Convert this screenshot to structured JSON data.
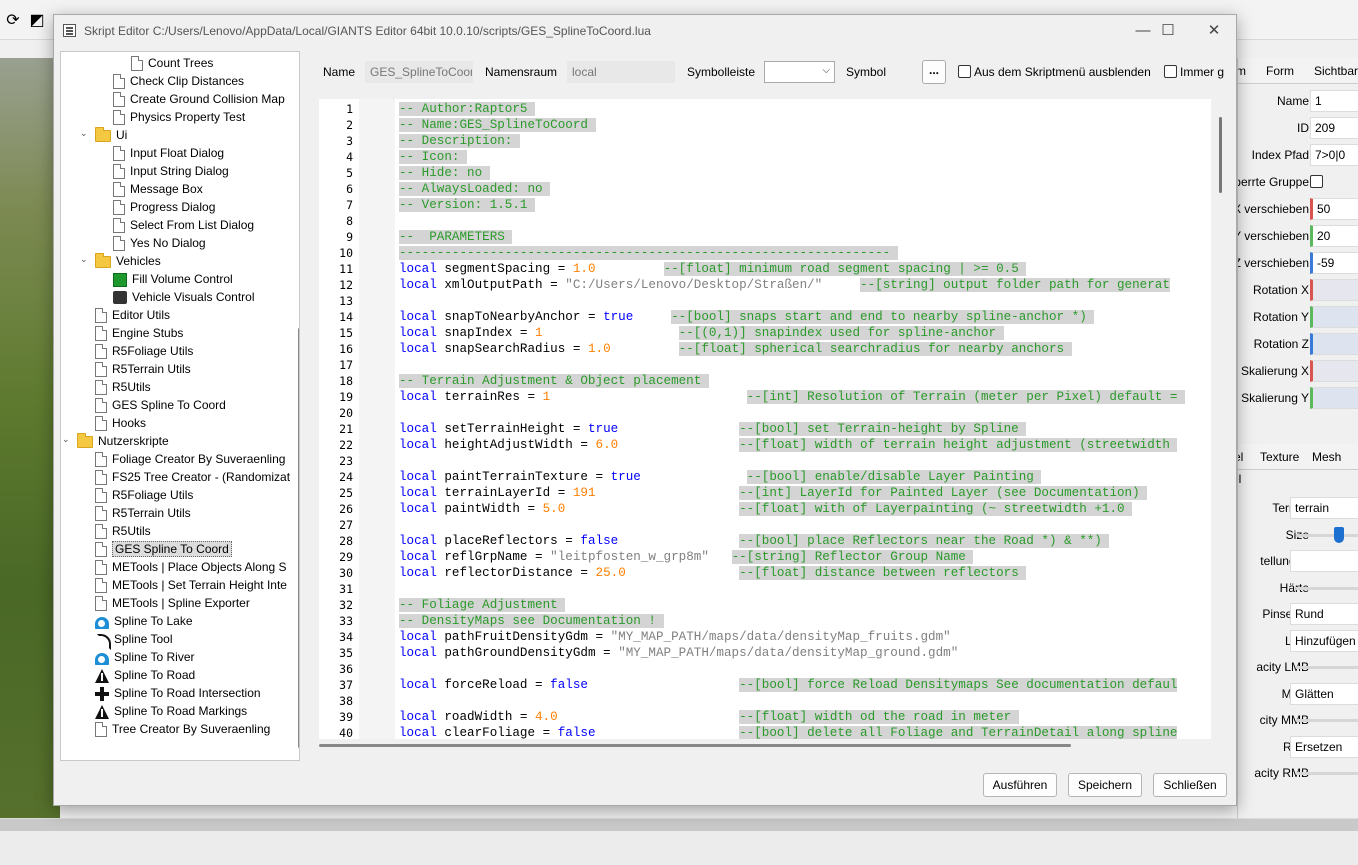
{
  "dialog": {
    "title": "Skript Editor C:/Users/Lenovo/AppData/Local/GIANTS Editor 64bit 10.0.10/scripts/GES_SplineToCoord.lua",
    "name_label": "Name",
    "name_value": "GES_SplineToCoord",
    "namespace_label": "Namensraum",
    "namespace_value": "local",
    "toolbar_label": "Symbolleiste",
    "symbol_label": "Symbol",
    "symbol_button": "...",
    "hide_label": "Aus dem Skriptmenü ausblenden",
    "always_label": "Immer g",
    "buttons": {
      "run": "Ausführen",
      "save": "Speichern",
      "close": "Schließen"
    }
  },
  "tree": [
    {
      "label": "Count Trees",
      "icon": "doc"
    },
    {
      "label": "Check Clip Distances",
      "icon": "doc"
    },
    {
      "label": "Create Ground Collision Map",
      "icon": "doc"
    },
    {
      "label": "Physics Property Test",
      "icon": "doc"
    },
    {
      "label": "Ui",
      "icon": "folder"
    },
    {
      "label": "Input Float Dialog",
      "icon": "doc"
    },
    {
      "label": "Input String Dialog",
      "icon": "doc"
    },
    {
      "label": "Message Box",
      "icon": "doc"
    },
    {
      "label": "Progress Dialog",
      "icon": "doc"
    },
    {
      "label": "Select From List Dialog",
      "icon": "doc"
    },
    {
      "label": "Yes No Dialog",
      "icon": "doc"
    },
    {
      "label": "Vehicles",
      "icon": "folder"
    },
    {
      "label": "Fill Volume Control",
      "icon": "green"
    },
    {
      "label": "Vehicle Visuals Control",
      "icon": "vehicle"
    },
    {
      "label": "Editor Utils",
      "icon": "doc"
    },
    {
      "label": "Engine Stubs",
      "icon": "doc"
    },
    {
      "label": "R5Foliage Utils",
      "icon": "doc"
    },
    {
      "label": "R5Terrain Utils",
      "icon": "doc"
    },
    {
      "label": "R5Utils",
      "icon": "doc"
    },
    {
      "label": "GES Spline To Coord",
      "icon": "doc"
    },
    {
      "label": "Hooks",
      "icon": "doc"
    },
    {
      "label": "Nutzerskripte",
      "icon": "folder"
    },
    {
      "label": "Foliage Creator By Suveraenling",
      "icon": "doc"
    },
    {
      "label": "FS25 Tree Creator - (Randomizat",
      "icon": "doc"
    },
    {
      "label": "R5Foliage Utils",
      "icon": "doc"
    },
    {
      "label": "R5Terrain Utils",
      "icon": "doc"
    },
    {
      "label": "R5Utils",
      "icon": "doc"
    },
    {
      "label": "GES Spline To Coord",
      "icon": "doc"
    },
    {
      "label": "METools | Place Objects Along S",
      "icon": "doc"
    },
    {
      "label": "METools | Set Terrain Height Inte",
      "icon": "doc"
    },
    {
      "label": "METools | Spline Exporter",
      "icon": "doc"
    },
    {
      "label": "Spline To Lake",
      "icon": "wave"
    },
    {
      "label": "Spline Tool",
      "icon": "curve"
    },
    {
      "label": "Spline To River",
      "icon": "wave"
    },
    {
      "label": "Spline To Road",
      "icon": "road"
    },
    {
      "label": "Spline To Road Intersection",
      "icon": "cross"
    },
    {
      "label": "Spline To Road Markings",
      "icon": "road"
    },
    {
      "label": "Tree Creator By Suveraenling",
      "icon": "doc"
    }
  ],
  "code_lines": [
    {
      "n": "1",
      "t": [
        [
          "cm",
          "-- Author:Raptor5 "
        ]
      ]
    },
    {
      "n": "2",
      "t": [
        [
          "cm",
          "-- Name:GES_SplineToCoord "
        ]
      ]
    },
    {
      "n": "3",
      "t": [
        [
          "cm",
          "-- Description: "
        ]
      ]
    },
    {
      "n": "4",
      "t": [
        [
          "cm",
          "-- Icon: "
        ]
      ]
    },
    {
      "n": "5",
      "t": [
        [
          "cm",
          "-- Hide: no "
        ]
      ]
    },
    {
      "n": "6",
      "t": [
        [
          "cm",
          "-- AlwaysLoaded: no "
        ]
      ]
    },
    {
      "n": "7",
      "t": [
        [
          "cm",
          "-- Version: 1.5.1 "
        ]
      ]
    },
    {
      "n": "8",
      "t": []
    },
    {
      "n": "9",
      "t": [
        [
          "cm",
          "--  PARAMETERS "
        ]
      ]
    },
    {
      "n": "10",
      "t": [
        [
          "cm",
          "----------------------------------------------------------------- "
        ]
      ]
    },
    {
      "n": "11",
      "t": [
        [
          "kw",
          "local"
        ],
        [
          "p",
          " segmentSpacing = "
        ],
        [
          "num",
          "1.0"
        ],
        [
          "p",
          "         "
        ],
        [
          "cm",
          "--[float] minimum road segment spacing | >= 0.5 "
        ]
      ]
    },
    {
      "n": "12",
      "t": [
        [
          "kw",
          "local"
        ],
        [
          "p",
          " xmlOutputPath = "
        ],
        [
          "str",
          "\"C:/Users/Lenovo/Desktop/Straßen/\""
        ],
        [
          "p",
          "     "
        ],
        [
          "cm",
          "--[string] output folder path for generat"
        ]
      ]
    },
    {
      "n": "13",
      "t": []
    },
    {
      "n": "14",
      "t": [
        [
          "kw",
          "local"
        ],
        [
          "p",
          " snapToNearbyAnchor = "
        ],
        [
          "kw",
          "true"
        ],
        [
          "p",
          "     "
        ],
        [
          "cm",
          "--[bool] snaps start and end to nearby spline-anchor *) "
        ]
      ]
    },
    {
      "n": "15",
      "t": [
        [
          "kw",
          "local"
        ],
        [
          "p",
          " snapIndex = "
        ],
        [
          "num",
          "1"
        ],
        [
          "p",
          "                  "
        ],
        [
          "cm",
          "--[(0,1)] snapindex used for spline-anchor "
        ]
      ]
    },
    {
      "n": "16",
      "t": [
        [
          "kw",
          "local"
        ],
        [
          "p",
          " snapSearchRadius = "
        ],
        [
          "num",
          "1.0"
        ],
        [
          "p",
          "         "
        ],
        [
          "cm",
          "--[float] spherical searchradius for nearby anchors "
        ]
      ]
    },
    {
      "n": "17",
      "t": []
    },
    {
      "n": "18",
      "t": [
        [
          "cm",
          "-- Terrain Adjustment & Object placement "
        ]
      ]
    },
    {
      "n": "19",
      "t": [
        [
          "kw",
          "local"
        ],
        [
          "p",
          " terrainRes = "
        ],
        [
          "num",
          "1"
        ],
        [
          "p",
          "                          "
        ],
        [
          "cm",
          "--[int] Resolution of Terrain (meter per Pixel) default = "
        ]
      ]
    },
    {
      "n": "20",
      "t": []
    },
    {
      "n": "21",
      "t": [
        [
          "kw",
          "local"
        ],
        [
          "p",
          " setTerrainHeight = "
        ],
        [
          "kw",
          "true"
        ],
        [
          "p",
          "                "
        ],
        [
          "cm",
          "--[bool] set Terrain-height by Spline "
        ]
      ]
    },
    {
      "n": "22",
      "t": [
        [
          "kw",
          "local"
        ],
        [
          "p",
          " heightAdjustWidth = "
        ],
        [
          "num",
          "6.0"
        ],
        [
          "p",
          "                "
        ],
        [
          "cm",
          "--[float] width of terrain height adjustment (streetwidth "
        ]
      ]
    },
    {
      "n": "23",
      "t": []
    },
    {
      "n": "24",
      "t": [
        [
          "kw",
          "local"
        ],
        [
          "p",
          " paintTerrainTexture = "
        ],
        [
          "kw",
          "true"
        ],
        [
          "p",
          "              "
        ],
        [
          "cm",
          "--[bool] enable/disable Layer Painting "
        ]
      ]
    },
    {
      "n": "25",
      "t": [
        [
          "kw",
          "local"
        ],
        [
          "p",
          " terrainLayerId = "
        ],
        [
          "num",
          "191"
        ],
        [
          "p",
          "                   "
        ],
        [
          "cm",
          "--[int] LayerId for Painted Layer (see Documentation) "
        ]
      ]
    },
    {
      "n": "26",
      "t": [
        [
          "kw",
          "local"
        ],
        [
          "p",
          " paintWidth = "
        ],
        [
          "num",
          "5.0"
        ],
        [
          "p",
          "                       "
        ],
        [
          "cm",
          "--[float] with of Layerpainting (~ streetwidth +1.0 "
        ]
      ]
    },
    {
      "n": "27",
      "t": []
    },
    {
      "n": "28",
      "t": [
        [
          "kw",
          "local"
        ],
        [
          "p",
          " placeReflectors = "
        ],
        [
          "kw",
          "false"
        ],
        [
          "p",
          "                "
        ],
        [
          "cm",
          "--[bool] place Reflectors near the Road *) & **) "
        ]
      ]
    },
    {
      "n": "29",
      "t": [
        [
          "kw",
          "local"
        ],
        [
          "p",
          " reflGrpName = "
        ],
        [
          "str",
          "\"leitpfosten_w_grp8m\""
        ],
        [
          "p",
          "   "
        ],
        [
          "cm",
          "--[string] Reflector Group Name "
        ]
      ]
    },
    {
      "n": "30",
      "t": [
        [
          "kw",
          "local"
        ],
        [
          "p",
          " reflectorDistance = "
        ],
        [
          "num",
          "25.0"
        ],
        [
          "p",
          "               "
        ],
        [
          "cm",
          "--[float] distance between reflectors "
        ]
      ]
    },
    {
      "n": "31",
      "t": []
    },
    {
      "n": "32",
      "t": [
        [
          "cm",
          "-- Foliage Adjustment "
        ]
      ]
    },
    {
      "n": "33",
      "t": [
        [
          "cm",
          "-- DensityMaps see Documentation ! "
        ]
      ]
    },
    {
      "n": "34",
      "t": [
        [
          "kw",
          "local"
        ],
        [
          "p",
          " pathFruitDensityGdm = "
        ],
        [
          "str",
          "\"MY_MAP_PATH/maps/data/densityMap_fruits.gdm\""
        ]
      ]
    },
    {
      "n": "35",
      "t": [
        [
          "kw",
          "local"
        ],
        [
          "p",
          " pathGroundDensityGdm = "
        ],
        [
          "str",
          "\"MY_MAP_PATH/maps/data/densityMap_ground.gdm\""
        ]
      ]
    },
    {
      "n": "36",
      "t": []
    },
    {
      "n": "37",
      "t": [
        [
          "kw",
          "local"
        ],
        [
          "p",
          " forceReload = "
        ],
        [
          "kw",
          "false"
        ],
        [
          "p",
          "                    "
        ],
        [
          "cm",
          "--[bool] force Reload Densitymaps See documentation defaul"
        ]
      ]
    },
    {
      "n": "38",
      "t": []
    },
    {
      "n": "39",
      "t": [
        [
          "kw",
          "local"
        ],
        [
          "p",
          " roadWidth = "
        ],
        [
          "num",
          "4.0"
        ],
        [
          "p",
          "                        "
        ],
        [
          "cm",
          "--[float] width od the road in meter "
        ]
      ]
    },
    {
      "n": "40",
      "t": [
        [
          "kw",
          "local"
        ],
        [
          "p",
          " clearFoliage = "
        ],
        [
          "kw",
          "false"
        ],
        [
          "p",
          "                   "
        ],
        [
          "cm",
          "--[bool] delete all Foliage and TerrainDetail along spline"
        ]
      ]
    }
  ],
  "attr_panel": {
    "tabs1": [
      "rm",
      "Form",
      "Sichtbark"
    ],
    "props": [
      {
        "label": "Name",
        "value": "1"
      },
      {
        "label": "ID",
        "value": "209"
      },
      {
        "label": "Index Pfad",
        "value": "7>0|0"
      },
      {
        "label": "perrte Gruppe",
        "value": ""
      },
      {
        "label": "X verschieben",
        "value": "50"
      },
      {
        "label": "Y verschieben",
        "value": "20"
      },
      {
        "label": "Z verschieben",
        "value": "-59"
      },
      {
        "label": "Rotation X",
        "value": ""
      },
      {
        "label": "Rotation Y",
        "value": ""
      },
      {
        "label": "Rotation Z",
        "value": ""
      },
      {
        "label": "Skalierung X",
        "value": ""
      },
      {
        "label": "Skalierung Y",
        "value": ""
      }
    ],
    "tabs2": [
      "el",
      "Texture",
      "Mesh"
    ],
    "subtitle": "el",
    "brush": [
      {
        "label": "Terrain",
        "value": "terrain"
      },
      {
        "label": "Size",
        "value": ""
      },
      {
        "label": "tellungen",
        "value": ""
      },
      {
        "label": "Härte",
        "value": ""
      },
      {
        "label": "Pinselart",
        "value": "Rund"
      },
      {
        "label": "LMT",
        "value": "Hinzufügen"
      },
      {
        "label": "acity LMB",
        "value": ""
      },
      {
        "label": "MMT",
        "value": "Glätten"
      },
      {
        "label": "city MMB",
        "value": ""
      },
      {
        "label": "RMT",
        "value": "Ersetzen"
      },
      {
        "label": "acity RMB",
        "value": ""
      }
    ]
  },
  "colors": {
    "keyword": "#0000ff",
    "number": "#ff8000",
    "string": "#808080",
    "comment": "#2b9a2b",
    "comment_bg": "#d4d4d4"
  },
  "icons": {
    "refresh": "refresh-icon",
    "frame": "frame-icon"
  }
}
